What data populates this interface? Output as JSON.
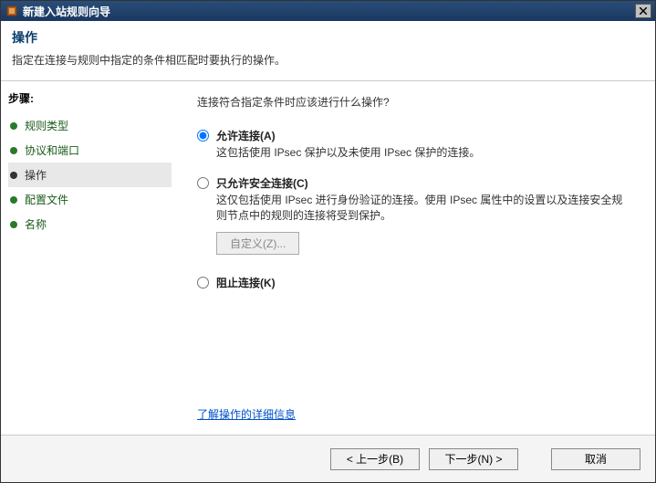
{
  "window": {
    "title": "新建入站规则向导"
  },
  "header": {
    "title": "操作",
    "subtitle": "指定在连接与规则中指定的条件相匹配时要执行的操作。"
  },
  "sidebar": {
    "title": "步骤:",
    "steps": [
      {
        "label": "规则类型",
        "active": false
      },
      {
        "label": "协议和端口",
        "active": false
      },
      {
        "label": "操作",
        "active": true
      },
      {
        "label": "配置文件",
        "active": false
      },
      {
        "label": "名称",
        "active": false
      }
    ]
  },
  "main": {
    "question": "连接符合指定条件时应该进行什么操作?",
    "options": [
      {
        "id": "allow",
        "label": "允许连接(A)",
        "desc": "这包括使用 IPsec 保护以及未使用 IPsec 保护的连接。",
        "checked": true
      },
      {
        "id": "allow-secure",
        "label": "只允许安全连接(C)",
        "desc": "这仅包括使用 IPsec 进行身份验证的连接。使用 IPsec 属性中的设置以及连接安全规则节点中的规则的连接将受到保护。",
        "checked": false
      },
      {
        "id": "block",
        "label": "阻止连接(K)",
        "desc": "",
        "checked": false
      }
    ],
    "customize_label": "自定义(Z)...",
    "learn_more": "了解操作的详细信息"
  },
  "footer": {
    "back": "< 上一步(B)",
    "next": "下一步(N) >",
    "cancel": "取消"
  }
}
